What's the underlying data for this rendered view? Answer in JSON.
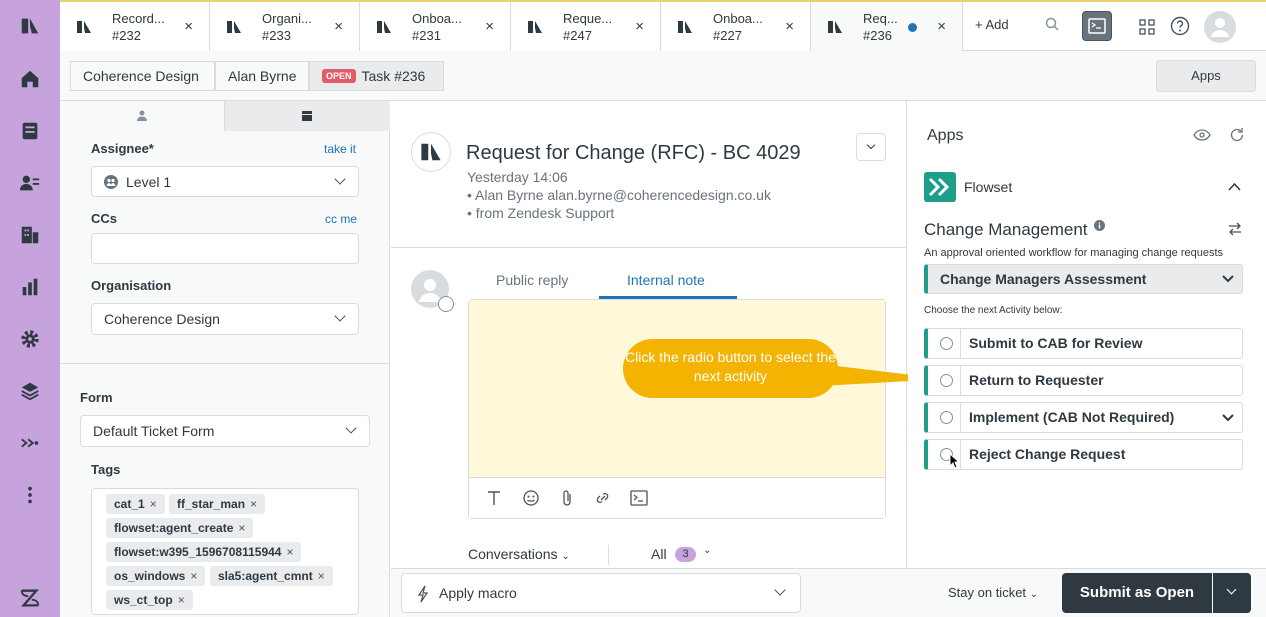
{
  "colors": {
    "accent": "#1f73b7",
    "nav": "#c6a3dd",
    "open_badge": "#e35b66",
    "callout": "#f3b300",
    "flowset": "#1c9e8b"
  },
  "nav": {
    "icons": [
      "zendesk-logo-icon",
      "home-icon",
      "views-icon",
      "customers-icon",
      "organizations-icon",
      "reporting-icon",
      "admin-gear-icon",
      "stack-icon",
      "flow-arrows-icon",
      "more-dots-icon",
      "zendesk-z-icon"
    ]
  },
  "tabs": [
    {
      "title": "Record...",
      "number": "#232"
    },
    {
      "title": "Organi...",
      "number": "#233"
    },
    {
      "title": "Onboa...",
      "number": "#231"
    },
    {
      "title": "Reque...",
      "number": "#247"
    },
    {
      "title": "Onboa...",
      "number": "#227"
    },
    {
      "title": "Req...",
      "number": "#236"
    }
  ],
  "topbar": {
    "add_label": "+ Add",
    "close_glyph": "×"
  },
  "breadcrumb": {
    "org": "Coherence Design",
    "user": "Alan Byrne",
    "badge": "OPEN",
    "task": "Task #236"
  },
  "apps_button": "Apps",
  "left": {
    "assignee_label": "Assignee*",
    "take_it": "take it",
    "assignee_value": "Level 1",
    "ccs_label": "CCs",
    "cc_me": "cc me",
    "org_label": "Organisation",
    "org_value": "Coherence Design",
    "form_label": "Form",
    "form_value": "Default Ticket Form",
    "tags_label": "Tags",
    "tags": [
      "cat_1",
      "ff_star_man",
      "flowset:agent_create",
      "flowset:w395_1596708115944",
      "os_windows",
      "sla5:agent_cmnt",
      "ws_ct_top"
    ]
  },
  "ticket": {
    "title": "Request for Change (RFC) - BC 4029",
    "time": "Yesterday 14:06",
    "from_line": "• Alan Byrne   alan.byrne@coherencedesign.co.uk",
    "via_line": "• from Zendesk Support",
    "public_reply": "Public reply",
    "internal_note": "Internal note",
    "callout": "Click the radio button to select the next activity",
    "conversations": "Conversations",
    "all_label": "All",
    "all_count": "3"
  },
  "bottom": {
    "macro": "Apply macro",
    "stay": "Stay on ticket",
    "submit": "Submit as Open"
  },
  "apps": {
    "title": "Apps",
    "app_name": "Flowset",
    "workflow_title": "Change Management",
    "workflow_desc": "An approval oriented workflow for managing change requests",
    "current_state": "Change Managers Assessment",
    "choose_label": "Choose the next Activity below:",
    "activities": [
      "Submit to CAB for Review",
      "Return to Requester",
      "Implement (CAB Not Required)",
      "Reject Change Request"
    ]
  }
}
